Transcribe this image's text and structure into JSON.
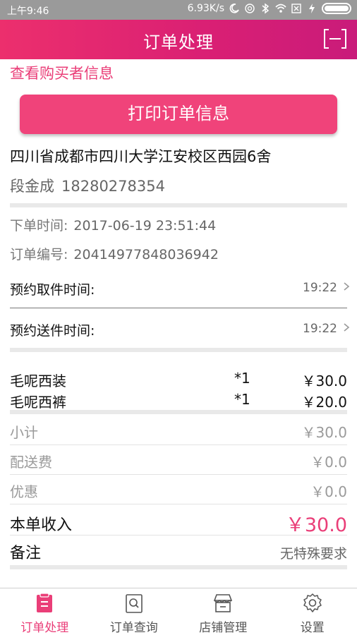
{
  "status_bar": {
    "time": "上午9:46",
    "speed": "6.93K/s"
  },
  "header": {
    "title": "订单处理"
  },
  "buyer_link": "查看购买者信息",
  "print_button": "打印订单信息",
  "address": "四川省成都市四川大学江安校区西园6舍",
  "contact": {
    "name": "段金成",
    "phone": "18280278354"
  },
  "order_info": {
    "time_label": "下单时间:",
    "time_value": "2017-06-19 23:51:44",
    "number_label": "订单编号:",
    "number_value": "20414977848036942"
  },
  "schedule": {
    "pickup_label": "预约取件时间:",
    "pickup_time": "19:22",
    "delivery_label": "预约送件时间:",
    "delivery_time": "19:22"
  },
  "items": [
    {
      "name": "毛呢西装",
      "qty": "*1",
      "price": "￥30.0"
    },
    {
      "name": "毛呢西裤",
      "qty": "*1",
      "price": "￥20.0"
    }
  ],
  "summary": {
    "subtotal_label": "小计",
    "subtotal_value": "￥30.0",
    "delivery_fee_label": "配送费",
    "delivery_fee_value": "￥0.0",
    "discount_label": "优惠",
    "discount_value": "￥0.0",
    "income_label": "本单收入",
    "income_value": "￥30.0",
    "note_label": "备注",
    "note_value": "无特殊要求"
  },
  "tabs": [
    {
      "label": "订单处理",
      "icon": "order-icon",
      "active": true
    },
    {
      "label": "订单查询",
      "icon": "search-order-icon",
      "active": false
    },
    {
      "label": "店铺管理",
      "icon": "store-icon",
      "active": false
    },
    {
      "label": "设置",
      "icon": "gear-icon",
      "active": false
    }
  ],
  "colors": {
    "accent": "#ea3e78",
    "header_start": "#ec2f6d",
    "header_end": "#c91b7a",
    "button": "#f0437a"
  }
}
